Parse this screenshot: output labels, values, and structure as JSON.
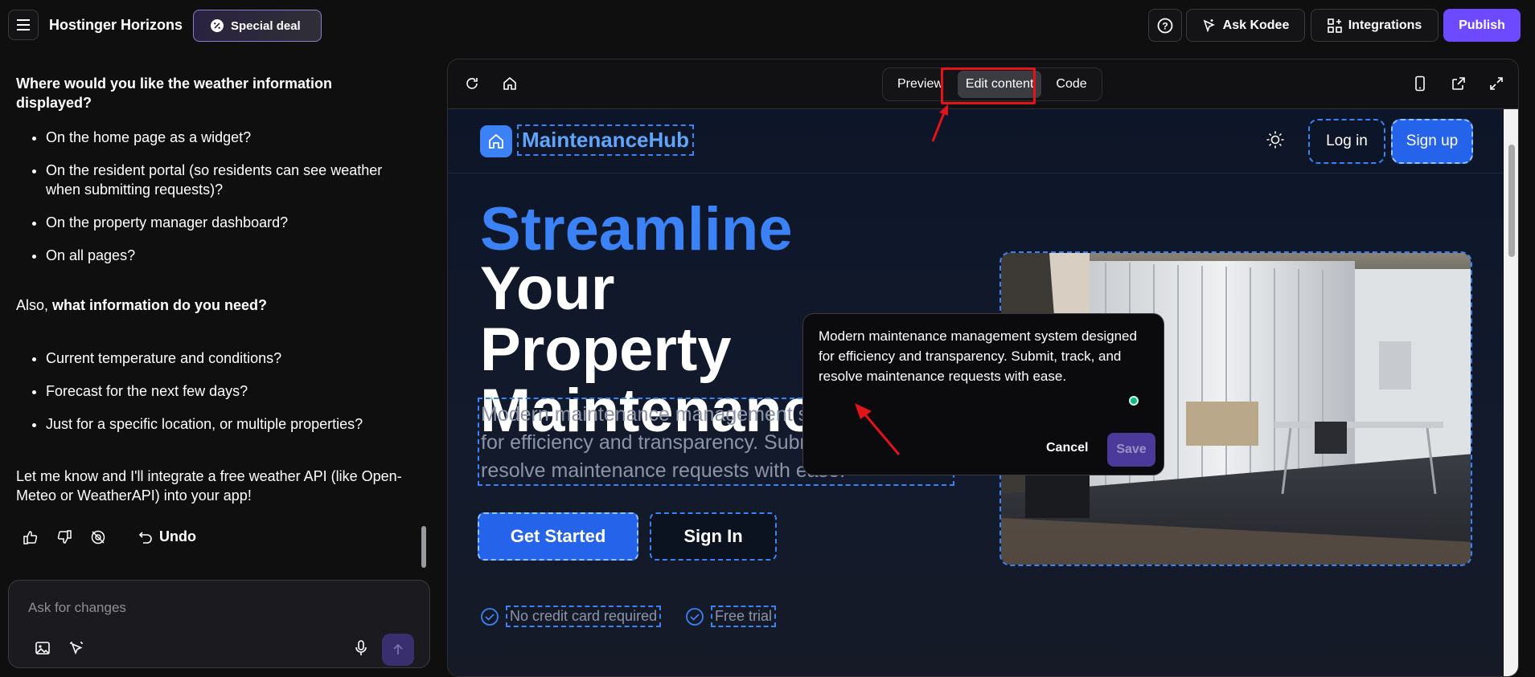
{
  "topbar": {
    "brand": "Hostinger Horizons",
    "special_deal": "Special deal",
    "ask_kodee": "Ask Kodee",
    "integrations": "Integrations",
    "publish": "Publish",
    "accent": "#6d4aff"
  },
  "chat": {
    "question": "Where would you like the weather information displayed?",
    "locations": [
      "On the home page as a widget?",
      "On the resident portal (so residents can see weather when submitting requests)?",
      "On the property manager dashboard?",
      "On all pages?"
    ],
    "info_prefix": "Also, ",
    "info_bold": "what information do you need?",
    "info_items": [
      "Current temperature and conditions?",
      "Forecast for the next few days?",
      "Just for a specific location, or multiple properties?"
    ],
    "closing": "Let me know and I'll integrate a free weather API (like Open-Meteo or WeatherAPI) into your app!",
    "undo": "Undo",
    "composer_placeholder": "Ask for changes"
  },
  "preview": {
    "tabs": [
      "Preview",
      "Edit content",
      "Code"
    ],
    "active_tab": "Edit content"
  },
  "site": {
    "logo": "MaintenanceHub",
    "login": "Log in",
    "signup": "Sign up",
    "headline_accent": "Streamline",
    "headline_rest": "Your Property Maintenance",
    "description": "Modern maintenance management system designed for efficiency and transparency. Submit, track, and resolve maintenance requests with ease.",
    "get_started": "Get Started",
    "sign_in": "Sign In",
    "perks": [
      "No credit card required",
      "Free trial"
    ],
    "brand_color": "#3b82f6"
  },
  "editor_popup": {
    "text": "Modern maintenance management system designed for efficiency and transparency. Submit, track, and resolve maintenance requests with ease.",
    "cancel": "Cancel",
    "save": "Save"
  }
}
